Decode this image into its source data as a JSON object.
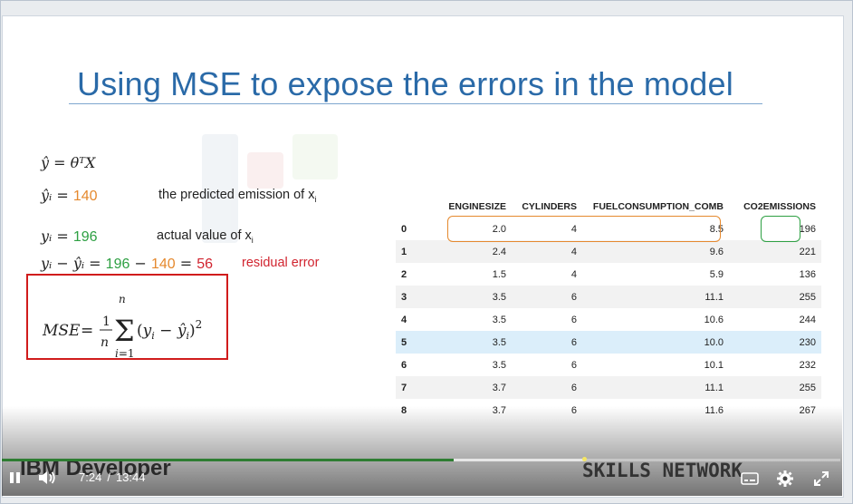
{
  "slide": {
    "title": "Using MSE to expose the errors in the model",
    "formulas": {
      "yhat_def": "ŷ = θᵀX",
      "yhat_i_lhs": "ŷᵢ = ",
      "yhat_i_val": "140",
      "y_i_lhs": "yᵢ = ",
      "y_i_val": "196",
      "residual_lhs": "yᵢ − ŷᵢ = ",
      "residual_a": "196",
      "residual_minus": " − ",
      "residual_b": "140",
      "residual_eq": " = ",
      "residual_result": "56"
    },
    "labels": {
      "predicted": "the predicted emission of x",
      "predicted_sub": "i",
      "actual": "actual value of x",
      "actual_sub": "i",
      "residual_error": "residual error"
    },
    "mse_formula": "MSE = 1/n Σ (yᵢ − ŷᵢ)²",
    "table": {
      "columns": [
        "",
        "ENGINESIZE",
        "CYLINDERS",
        "FUELCONSUMPTION_COMB",
        "CO2EMISSIONS"
      ],
      "rows": [
        [
          "0",
          "2.0",
          "4",
          "8.5",
          "196"
        ],
        [
          "1",
          "2.4",
          "4",
          "9.6",
          "221"
        ],
        [
          "2",
          "1.5",
          "4",
          "5.9",
          "136"
        ],
        [
          "3",
          "3.5",
          "6",
          "11.1",
          "255"
        ],
        [
          "4",
          "3.5",
          "6",
          "10.6",
          "244"
        ],
        [
          "5",
          "3.5",
          "6",
          "10.0",
          "230"
        ],
        [
          "6",
          "3.5",
          "6",
          "10.1",
          "232"
        ],
        [
          "7",
          "3.7",
          "6",
          "11.1",
          "255"
        ],
        [
          "8",
          "3.7",
          "6",
          "11.6",
          "267"
        ]
      ],
      "highlighted_row": 5
    }
  },
  "player": {
    "current_time": "7:24",
    "separator": "/",
    "duration": "13:44",
    "progress_fraction": 0.539,
    "brand_left": "IBM Developer",
    "brand_right": "SKILLS NETWORK",
    "icons": [
      "pause-icon",
      "volume-icon",
      "captions-icon",
      "settings-icon",
      "fullscreen-icon"
    ]
  },
  "colors": {
    "title": "#2a6aa8",
    "predicted": "#e5892e",
    "actual": "#2ea043",
    "residual": "#d1242f",
    "progress": "#2e7d32"
  }
}
